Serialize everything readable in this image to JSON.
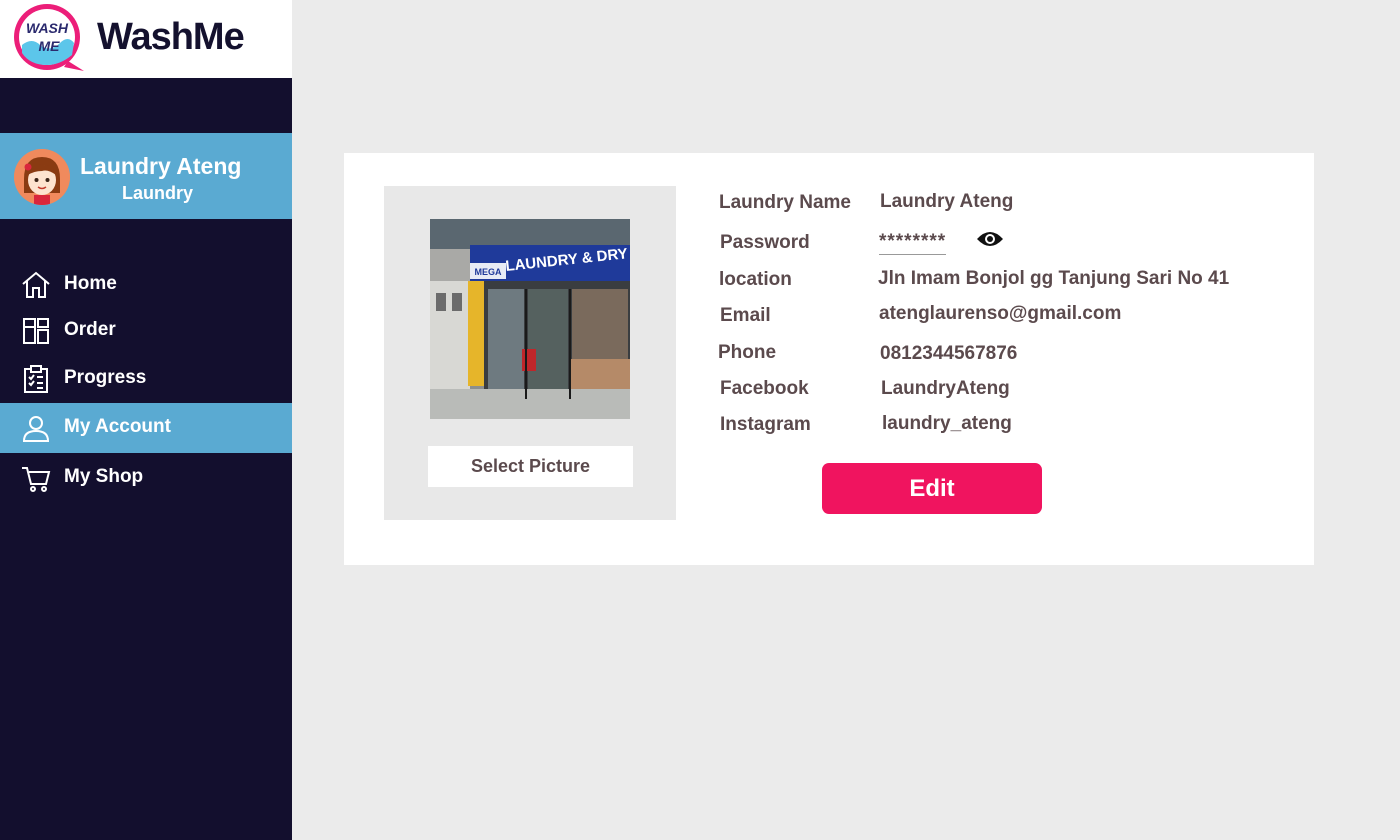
{
  "app": {
    "name": "WashMe",
    "logo_text_top": "WASH",
    "logo_text_bottom": "ME"
  },
  "colors": {
    "sidebar_bg": "#130f2e",
    "accent_blue": "#5aaad2",
    "edit_button": "#f0145f",
    "text": "#5b4a4d"
  },
  "profile": {
    "name": "Laundry Ateng",
    "role": "Laundry"
  },
  "nav": [
    {
      "label": "Home",
      "icon": "home-icon",
      "active": false
    },
    {
      "label": "Order",
      "icon": "dashboard-icon",
      "active": false
    },
    {
      "label": "Progress",
      "icon": "clipboard-check-icon",
      "active": false
    },
    {
      "label": "My Account",
      "icon": "user-icon",
      "active": true
    },
    {
      "label": "My Shop",
      "icon": "cart-icon",
      "active": false
    }
  ],
  "account": {
    "select_picture_label": "Select Picture",
    "shop_sign_text": "LAUNDRY & DRY CLEA",
    "shop_sign_brand": "MEGA",
    "fields": [
      {
        "label": "Laundry Name",
        "value": "Laundry Ateng"
      },
      {
        "label": "Password",
        "value": "********"
      },
      {
        "label": "location",
        "value": "Jln Imam Bonjol gg Tanjung Sari No 41"
      },
      {
        "label": "Email",
        "value": "atenglaurenso@gmail.com"
      },
      {
        "label": "Phone",
        "value": "0812344567876"
      },
      {
        "label": "Facebook",
        "value": "LaundryAteng"
      },
      {
        "label": "Instagram",
        "value": "laundry_ateng"
      }
    ],
    "edit_label": "Edit"
  }
}
